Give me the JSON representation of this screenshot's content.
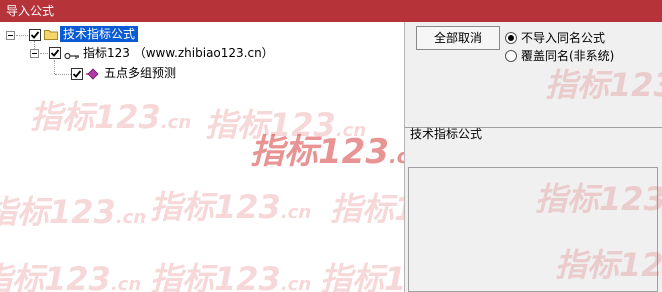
{
  "window": {
    "title": "导入公式"
  },
  "tree": {
    "root": {
      "label": "技术指标公式",
      "checked": true
    },
    "child": {
      "label": "指标123  （www.zhibiao123.cn）",
      "checked": true
    },
    "leaf": {
      "label": "五点多组预测",
      "checked": true
    }
  },
  "panel": {
    "deselect_all_button": "全部取消",
    "radio_skip_label": "不导入同名公式",
    "radio_overwrite_label": "覆盖同名(非系统)",
    "selected_option": "不导入同名公式",
    "category_label": "技术指标公式"
  },
  "watermark": {
    "text": "指标123",
    "suffix": ".cn"
  },
  "colors": {
    "titlebar": "#b63339",
    "selection": "#0a5bd3",
    "watermark": "#d63c3c"
  }
}
